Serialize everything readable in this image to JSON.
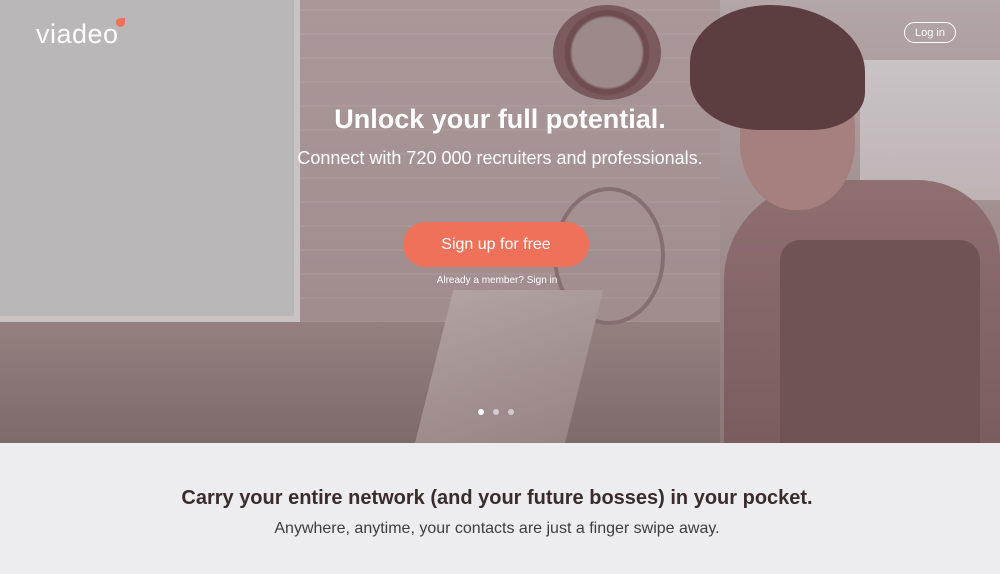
{
  "brand": {
    "logo_text": "viadeo",
    "accent_color": "#f0715a"
  },
  "header": {
    "login_label": "Log in"
  },
  "hero": {
    "headline": "Unlock your full potential.",
    "subheadline": "Connect with 720 000 recruiters and professionals.",
    "signup_label": "Sign up for free",
    "member_prompt": "Already a member?",
    "signin_label": "Sign in",
    "carousel": {
      "slide_count": 3,
      "active_index": 0
    }
  },
  "section": {
    "title": "Carry your entire network (and your future bosses) in your pocket.",
    "subtitle": "Anywhere, anytime, your contacts are just a finger swipe away."
  }
}
